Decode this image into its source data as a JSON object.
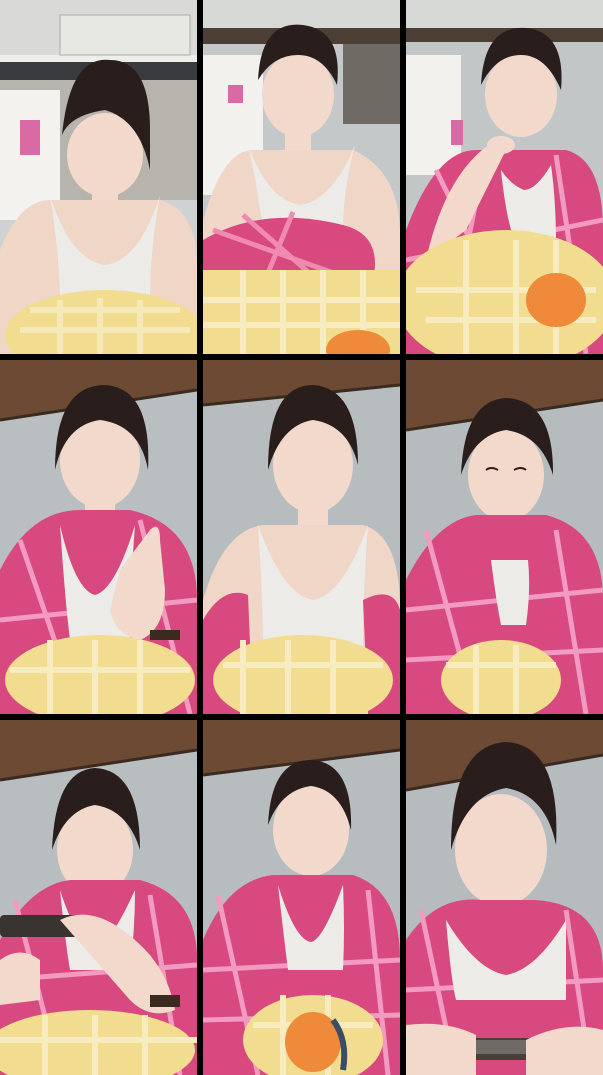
{
  "collage": {
    "rows": 3,
    "cols": 3,
    "tiles": [
      {
        "scene": "bunk",
        "shirt": "none",
        "pose": "neutral"
      },
      {
        "scene": "bunk",
        "shirt": "lap",
        "pose": "neutral"
      },
      {
        "scene": "bunk",
        "shirt": "on",
        "pose": "hand-face"
      },
      {
        "scene": "ceiling",
        "shirt": "on",
        "pose": "hand-up"
      },
      {
        "scene": "ceiling",
        "shirt": "sleeve",
        "pose": "neutral"
      },
      {
        "scene": "ceiling",
        "shirt": "on",
        "pose": "eyes-closed"
      },
      {
        "scene": "ceiling",
        "shirt": "on",
        "pose": "phone"
      },
      {
        "scene": "ceiling",
        "shirt": "on",
        "pose": "orange-pillow"
      },
      {
        "scene": "ceiling",
        "shirt": "on",
        "pose": "phone-low"
      }
    ]
  },
  "colors": {
    "skin": "#f3d9cc",
    "hair": "#2a1e1c",
    "tank": "#ecebe8",
    "plaid": "#d8497f",
    "pillow": "#f2dc8f",
    "orange": "#ee8a3a",
    "wall": "#b9bec0",
    "ceiling": "#6c4a33"
  }
}
